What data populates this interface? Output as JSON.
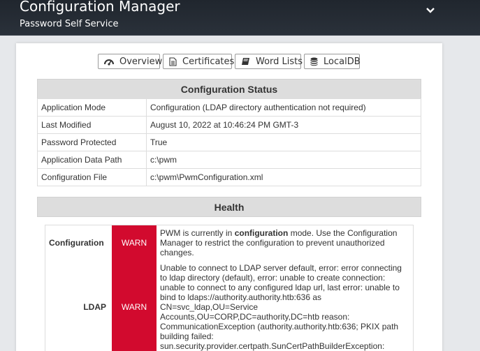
{
  "header": {
    "title": "Configuration Manager",
    "subtitle": "Password Self Service",
    "menu_icon": "chevron-down-icon"
  },
  "tabs": [
    {
      "label": "Overview",
      "icon": "dashboard-icon"
    },
    {
      "label": "Certificates",
      "icon": "file-text-icon"
    },
    {
      "label": "Word Lists",
      "icon": "book-icon"
    },
    {
      "label": "LocalDB",
      "icon": "database-icon"
    }
  ],
  "config_status": {
    "heading": "Configuration Status",
    "rows": [
      {
        "key": "Application Mode",
        "value": "Configuration (LDAP directory authentication not required)"
      },
      {
        "key": "Last Modified",
        "value": "August 10, 2022 at 10:46:24 PM GMT-3"
      },
      {
        "key": "Password Protected",
        "value": "True"
      },
      {
        "key": "Application Data Path",
        "value": "c:\\pwm"
      },
      {
        "key": "Configuration File",
        "value": "c:\\pwm\\PwmConfiguration.xml"
      }
    ]
  },
  "health": {
    "heading": "Health",
    "status_color": "#d20a2e",
    "rows": [
      {
        "category": "Configuration",
        "status": "WARN",
        "message_pre": "PWM is currently in ",
        "message_bold": "configuration",
        "message_post": " mode. Use the Configuration Manager to restrict the configuration to prevent unauthorized changes."
      },
      {
        "category": "LDAP",
        "status": "WARN",
        "message": "Unable to connect to LDAP server default, error: error connecting to ldap directory (default), error: unable to create connection: unable to connect to any configured ldap url, last error: unable to bind to ldaps://authority.authority.htb:636 as CN=svc_ldap,OU=Service Accounts,OU=CORP,DC=authority,DC=htb reason: CommunicationException (authority.authority.htb:636; PKIX path building failed: sun.security.provider.certpath.SunCertPathBuilderException:"
      }
    ]
  }
}
